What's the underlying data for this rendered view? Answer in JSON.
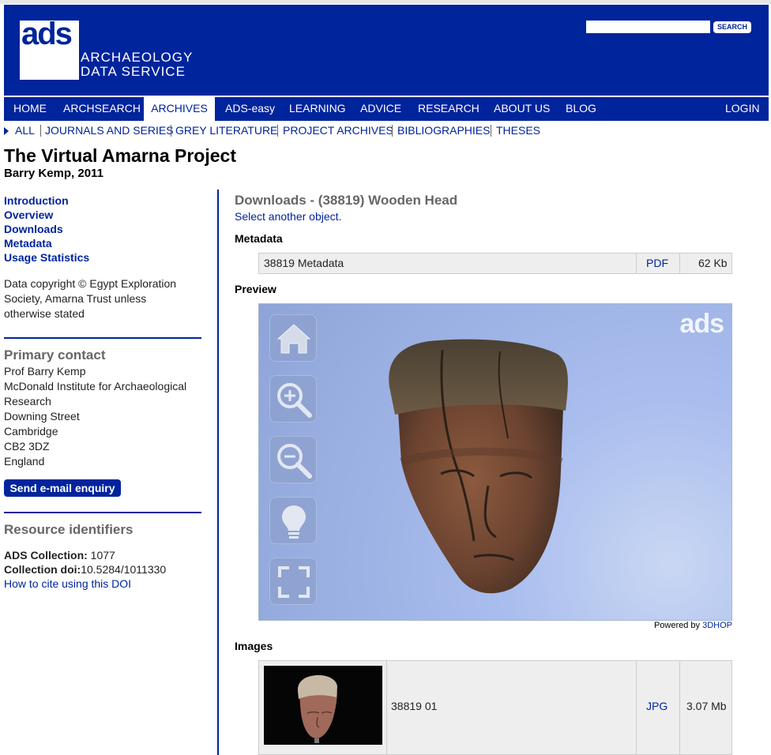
{
  "header": {
    "logo_text": "ads",
    "logo_line1": "ARCHAEOLOGY",
    "logo_line2": "DATA SERVICE",
    "search_placeholder": "",
    "search_button": "SEARCH"
  },
  "main_nav": {
    "items": [
      "HOME",
      "ARCHSEARCH",
      "ARCHIVES",
      "ADS-easy",
      "LEARNING",
      "ADVICE",
      "RESEARCH",
      "ABOUT US",
      "BLOG"
    ],
    "active": "ARCHIVES",
    "login": "LOGIN"
  },
  "sub_nav": {
    "items": [
      "ALL",
      "JOURNALS AND SERIES",
      "GREY LITERATURE",
      "PROJECT ARCHIVES",
      "BIBLIOGRAPHIES",
      "THESES"
    ]
  },
  "page": {
    "title": "The Virtual Amarna Project",
    "subtitle": "Barry Kemp, 2011"
  },
  "sidebar": {
    "links": [
      "Introduction",
      "Overview",
      "Downloads",
      "Metadata",
      "Usage Statistics"
    ],
    "copyright_lines": [
      "Data copyright © Egypt Exploration",
      "Society, Amarna Trust unless",
      "otherwise stated"
    ],
    "contact_heading": "Primary contact",
    "contact_lines": [
      "Prof Barry Kemp",
      "McDonald Institute for Archaeological",
      "Research",
      "Downing Street",
      "Cambridge",
      "CB2 3DZ",
      "England"
    ],
    "email_button": "Send e-mail enquiry",
    "identifiers_heading": "Resource identifiers",
    "collection_label": "ADS Collection:",
    "collection_value": "1077",
    "doi_label": "Collection doi:",
    "doi_value": "10.5284/1011330",
    "cite_link": "How to cite using this DOI"
  },
  "content": {
    "title": "Downloads - (38819) Wooden Head",
    "select_link": "Select another object.",
    "metadata_heading": "Metadata",
    "metadata_row": {
      "name": "38819 Metadata",
      "format": "PDF",
      "size": "62 Kb"
    },
    "preview_heading": "Preview",
    "viewer_logo": "ads",
    "viewer_buttons": [
      "home-icon",
      "zoom-in-icon",
      "zoom-out-icon",
      "light-bulb-icon",
      "fullscreen-icon"
    ],
    "powered_by": "Powered by",
    "powered_link": "3DHOP",
    "images_heading": "Images",
    "image_row": {
      "name": "38819 01",
      "format": "JPG",
      "size": "3.07 Mb"
    }
  },
  "colors": {
    "brand_blue": "#00249c",
    "heading_grey": "#666666",
    "table_bg": "#eeeeee"
  }
}
